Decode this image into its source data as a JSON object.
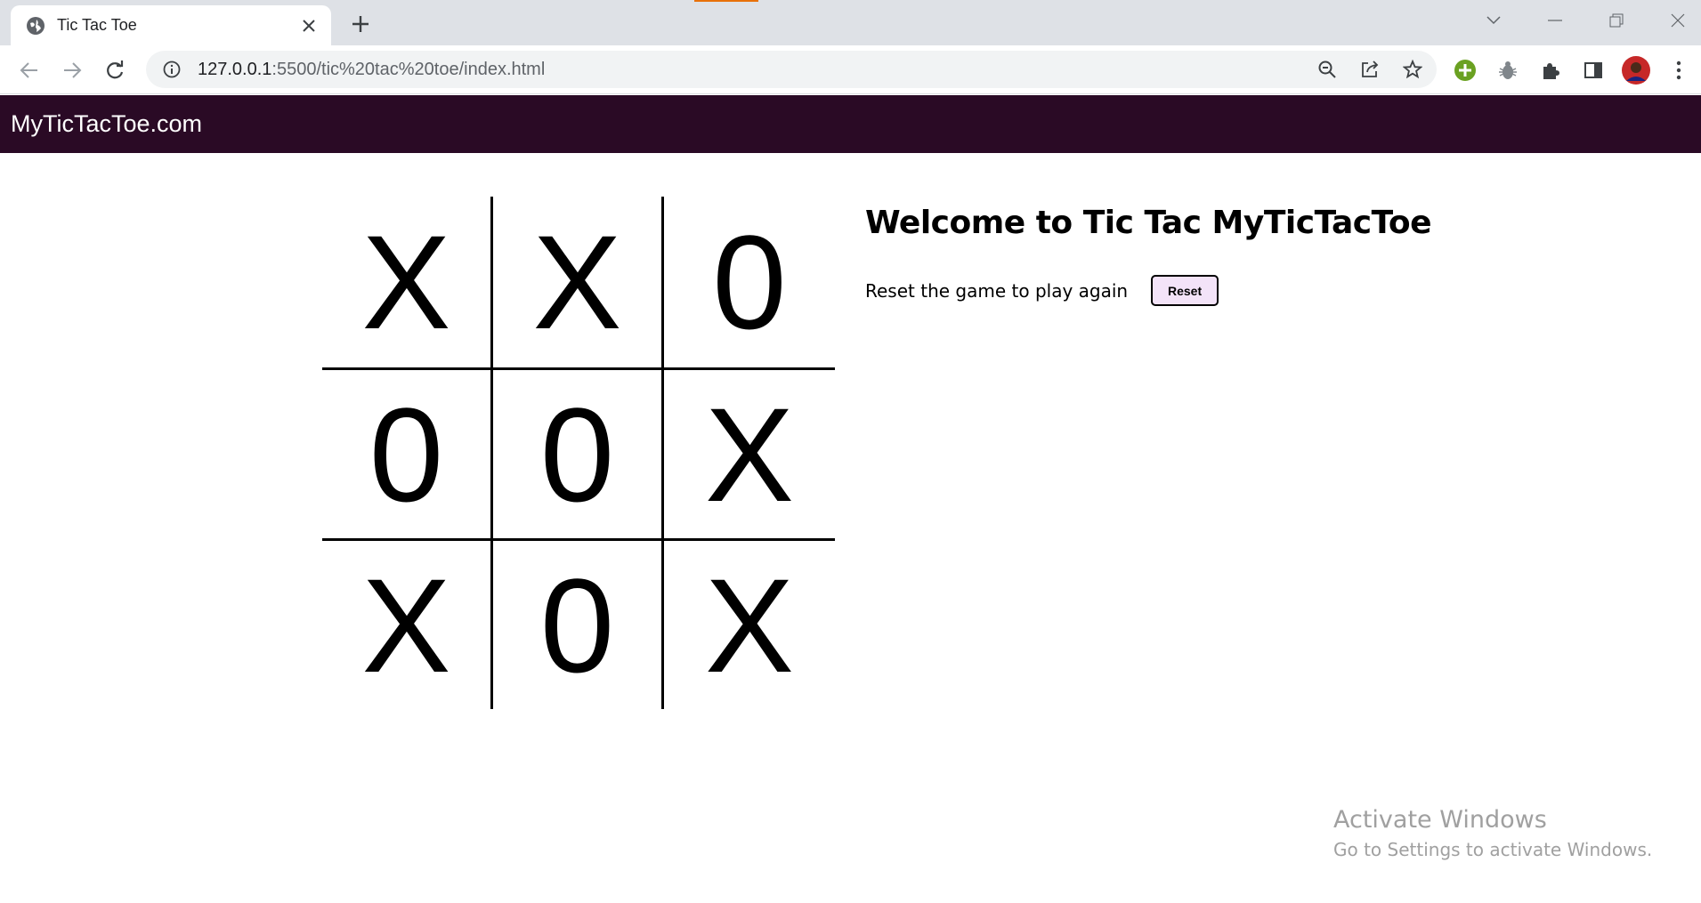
{
  "browser": {
    "tab_title": "Tic Tac Toe",
    "url_host": "127.0.0.1",
    "url_path": ":5500/tic%20tac%20toe/index.html",
    "icons": [
      "globe-icon",
      "close-icon",
      "plus-icon",
      "back-icon",
      "forward-icon",
      "reload-icon",
      "info-icon",
      "zoom-out-icon",
      "share-icon",
      "star-icon",
      "extension-add-icon",
      "bug-icon",
      "puzzle-icon",
      "side-panel-icon",
      "avatar",
      "more-icon",
      "chevron-down-icon",
      "minimize-icon",
      "restore-icon",
      "window-close-icon"
    ]
  },
  "navbar": {
    "brand": "MyTicTacToe.com",
    "background": "#2a0a25"
  },
  "board": {
    "cells": [
      "X",
      "X",
      "0",
      "0",
      "0",
      "X",
      "X",
      "0",
      "X"
    ]
  },
  "info": {
    "heading": "Welcome to Tic Tac MyTicTacToe",
    "reset_text": "Reset the game to play again",
    "reset_button": "Reset",
    "reset_button_color": "#f3e3f8"
  },
  "watermark": {
    "title": "Activate Windows",
    "subtitle": "Go to Settings to activate Windows."
  }
}
